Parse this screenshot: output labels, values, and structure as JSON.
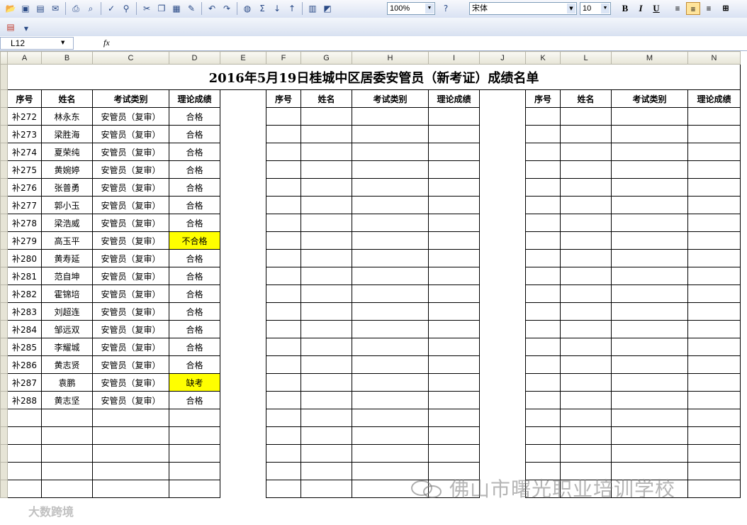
{
  "toolbar": {
    "zoom": "100%",
    "font_name": "宋体",
    "font_size": "10",
    "bold": "B",
    "italic": "I",
    "underline": "U"
  },
  "formula_bar": {
    "name_box": "L12",
    "fx": "fx"
  },
  "columns": [
    "A",
    "B",
    "C",
    "D",
    "E",
    "F",
    "G",
    "H",
    "I",
    "J",
    "K",
    "L",
    "M",
    "N"
  ],
  "sheet_title": "2016年5月19日桂城中区居委安管员（新考证）成绩名单",
  "headers": [
    "序号",
    "姓名",
    "考试类别",
    "理论成绩"
  ],
  "rows": [
    {
      "no": "补272",
      "name": "林永东",
      "type": "安管员（复审）",
      "score": "合格"
    },
    {
      "no": "补273",
      "name": "梁胜海",
      "type": "安管员（复审）",
      "score": "合格"
    },
    {
      "no": "补274",
      "name": "夏荣纯",
      "type": "安管员（复审）",
      "score": "合格"
    },
    {
      "no": "补275",
      "name": "黄婉婷",
      "type": "安管员（复审）",
      "score": "合格"
    },
    {
      "no": "补276",
      "name": "张普勇",
      "type": "安管员（复审）",
      "score": "合格"
    },
    {
      "no": "补277",
      "name": "郭小玉",
      "type": "安管员（复审）",
      "score": "合格"
    },
    {
      "no": "补278",
      "name": "梁浩威",
      "type": "安管员（复审）",
      "score": "合格"
    },
    {
      "no": "补279",
      "name": "高玉平",
      "type": "安管员（复审）",
      "score": "不合格",
      "highlight": true
    },
    {
      "no": "补280",
      "name": "黄寿延",
      "type": "安管员（复审）",
      "score": "合格"
    },
    {
      "no": "补281",
      "name": "范自坤",
      "type": "安管员（复审）",
      "score": "合格"
    },
    {
      "no": "补282",
      "name": "霍锦培",
      "type": "安管员（复审）",
      "score": "合格"
    },
    {
      "no": "补283",
      "name": "刘超连",
      "type": "安管员（复审）",
      "score": "合格"
    },
    {
      "no": "补284",
      "name": "邹远双",
      "type": "安管员（复审）",
      "score": "合格"
    },
    {
      "no": "补285",
      "name": "李耀城",
      "type": "安管员（复审）",
      "score": "合格"
    },
    {
      "no": "补286",
      "name": "黄志贤",
      "type": "安管员（复审）",
      "score": "合格"
    },
    {
      "no": "补287",
      "name": "袁鹏",
      "type": "安管员（复审）",
      "score": "缺考",
      "highlight": true
    },
    {
      "no": "补288",
      "name": "黄志坚",
      "type": "安管员（复审）",
      "score": "合格"
    }
  ],
  "watermark": "佛山市曙光职业培训学校",
  "watermark2": "大数跨境",
  "colors": {
    "highlight": "#ffff00"
  }
}
